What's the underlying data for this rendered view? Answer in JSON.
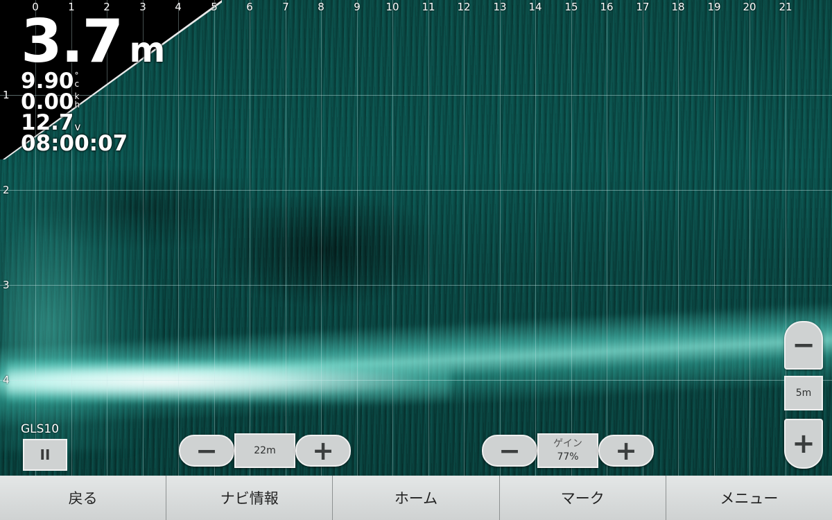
{
  "sonar": {
    "x_ticks": [
      "0",
      "1",
      "2",
      "3",
      "4",
      "5",
      "6",
      "7",
      "8",
      "9",
      "10",
      "11",
      "12",
      "13",
      "14",
      "15",
      "16",
      "17",
      "18",
      "19",
      "20",
      "21"
    ],
    "y_ticks": [
      "1",
      "2",
      "3",
      "4"
    ]
  },
  "readouts": {
    "depth_value": "3.7",
    "depth_unit": "m",
    "temperature_value": "9.90",
    "temperature_unit": "c",
    "temperature_degree_mark": "°",
    "speed_value": "0.00",
    "speed_unit_top": "k",
    "speed_unit_bottom": "h",
    "voltage_value": "12.7",
    "voltage_unit": "v",
    "clock": "08:00:07"
  },
  "source": {
    "label": "GLS10",
    "pause_icon_glyph": "II"
  },
  "range_control": {
    "minus_glyph": "−",
    "value": "22m",
    "plus_glyph": "+"
  },
  "gain_control": {
    "minus_glyph": "−",
    "label": "ゲイン",
    "value": "77%",
    "plus_glyph": "+"
  },
  "zoom_control": {
    "minus_glyph": "−",
    "value": "5m",
    "plus_glyph": "+"
  },
  "softkeys": {
    "back": "戻る",
    "nav_info": "ナビ情報",
    "home": "ホーム",
    "mark": "マーク",
    "menu": "メニュー"
  }
}
